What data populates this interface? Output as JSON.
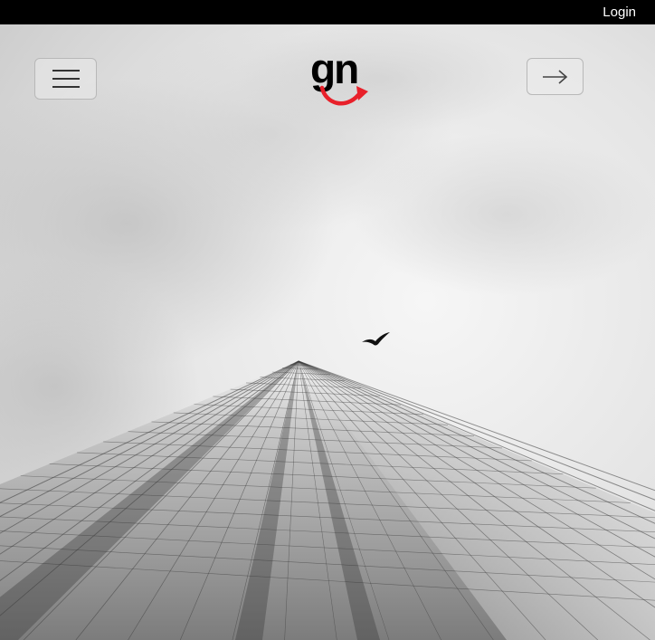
{
  "header": {
    "login_label": "Login"
  },
  "nav": {
    "menu_icon": "hamburger-menu-icon",
    "forward_icon": "arrow-right-icon"
  },
  "brand": {
    "logo_text": "gn",
    "accent_color": "#e8202a"
  },
  "colors": {
    "topbar": "#000000",
    "sky": "#e6e6e6",
    "building": "#8a8a8a"
  }
}
